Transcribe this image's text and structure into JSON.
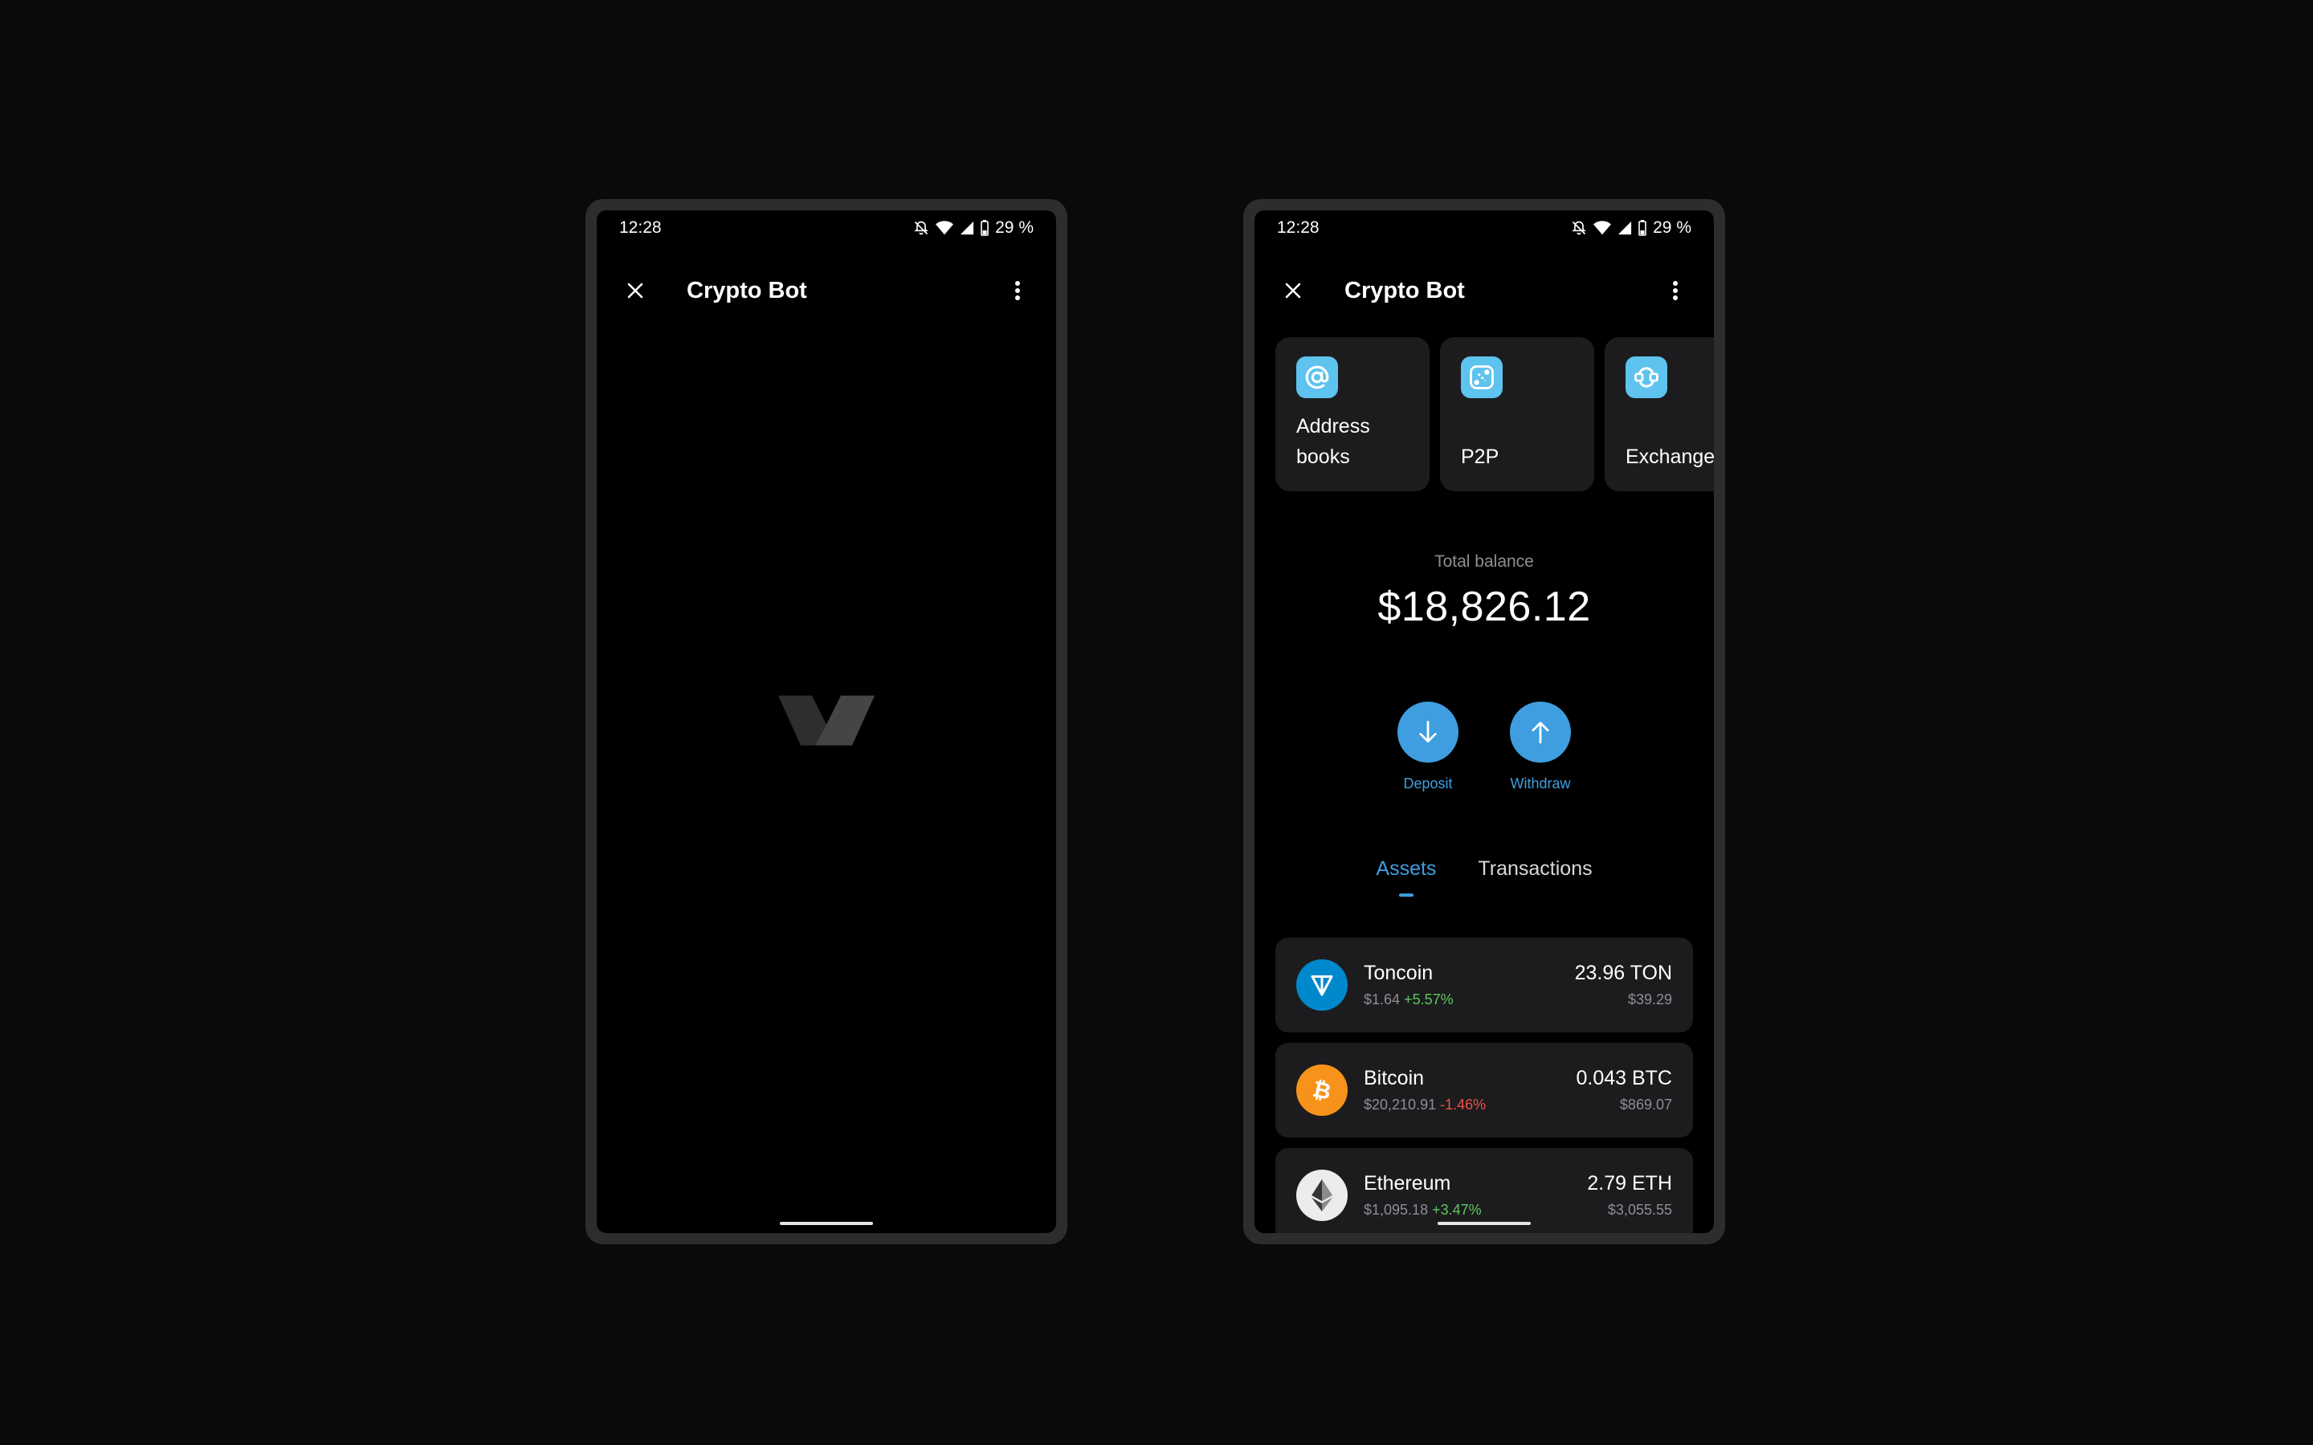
{
  "status": {
    "time": "12:28",
    "battery": "29 %"
  },
  "app": {
    "title": "Crypto Bot"
  },
  "quick_actions": [
    {
      "label": "Address\nbooks",
      "icon": "at-icon"
    },
    {
      "label": "P2P",
      "icon": "p2p-icon"
    },
    {
      "label": "Exchange",
      "icon": "exchange-icon"
    }
  ],
  "balance": {
    "caption": "Total balance",
    "amount": "$18,826.12"
  },
  "buttons": {
    "deposit": "Deposit",
    "withdraw": "Withdraw"
  },
  "tabs": {
    "assets": "Assets",
    "transactions": "Transactions"
  },
  "assets": [
    {
      "name": "Toncoin",
      "price": "$1.64",
      "change": "+5.57%",
      "qty": "23.96 TON",
      "fiat": "$39.29"
    },
    {
      "name": "Bitcoin",
      "price": "$20,210.91",
      "change": "-1.46%",
      "qty": "0.043 BTC",
      "fiat": "$869.07"
    },
    {
      "name": "Ethereum",
      "price": "$1,095.18",
      "change": "+3.47%",
      "qty": "2.79 ETH",
      "fiat": "$3,055.55"
    }
  ],
  "colors": {
    "accent": "#3e9ee0",
    "action_icon_bg": "#5ec3ee",
    "positive": "#5dc661",
    "negative": "#ec5146",
    "toncoin": "#0088cc",
    "bitcoin": "#f7931a",
    "ethereum": "#ececec"
  }
}
